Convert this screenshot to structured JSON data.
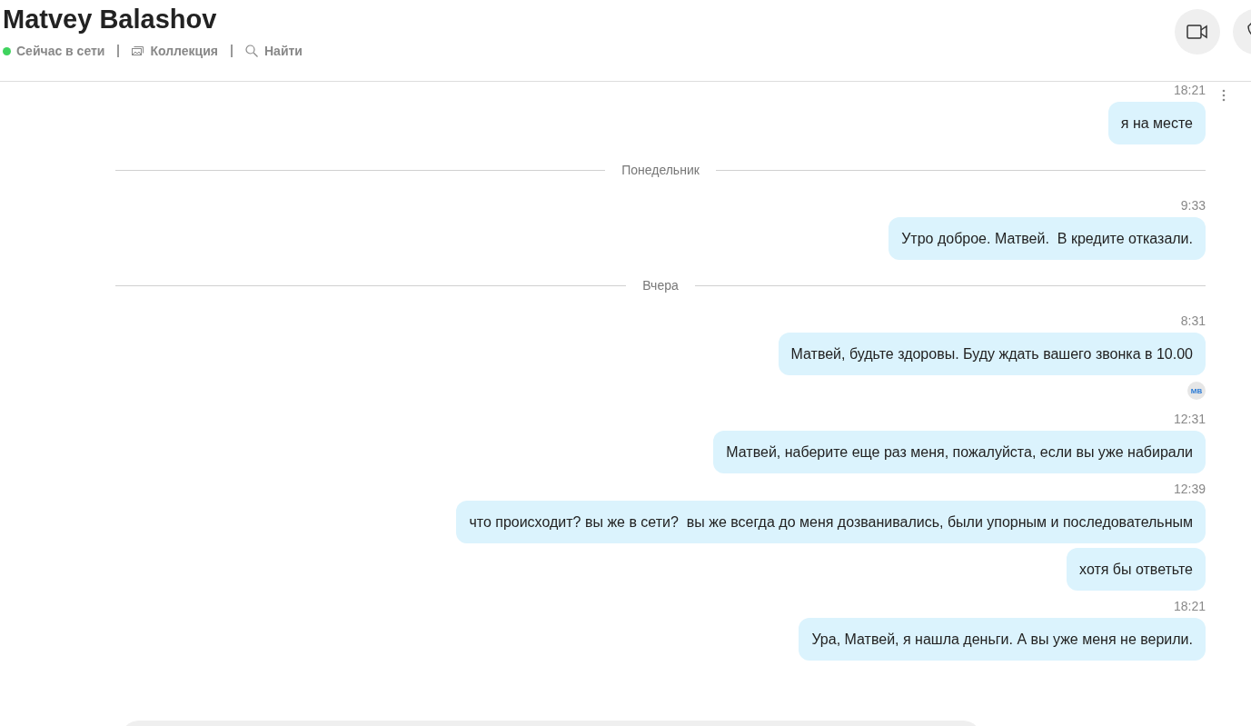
{
  "header": {
    "title": "Matvey Balashov",
    "status": {
      "label": "Сейчас в сети",
      "color": "#3fd35e"
    },
    "links": [
      {
        "kind": "gallery",
        "label": "Коллекция"
      },
      {
        "kind": "search",
        "label": "Найти"
      }
    ]
  },
  "messages": [
    {
      "kind": "message",
      "time": "18:21",
      "text": "я на месте"
    },
    {
      "kind": "divider",
      "label": "Понедельник"
    },
    {
      "kind": "message",
      "time": "9:33",
      "text": "Утро доброе. Матвей.  В кредите отказали."
    },
    {
      "kind": "divider",
      "label": "Вчера"
    },
    {
      "kind": "message",
      "time": "8:31",
      "text": "Матвей, будьте здоровы. Буду ждать вашего звонка в 10.00"
    },
    {
      "kind": "receipt",
      "initials": "MB"
    },
    {
      "kind": "message",
      "time": "12:31",
      "text": "Матвей, наберите еще раз меня, пожалуйста, если вы уже набирали"
    },
    {
      "kind": "message",
      "time": "12:39",
      "text": "что происходит? вы же в сети?  вы же всегда до меня дозванивались, были упорным и последовательным"
    },
    {
      "kind": "message",
      "text": "хотя бы ответьте"
    },
    {
      "kind": "message",
      "time": "18:21",
      "text": "Ура, Матвей, я нашла деньги. А вы уже меня не верили."
    }
  ]
}
